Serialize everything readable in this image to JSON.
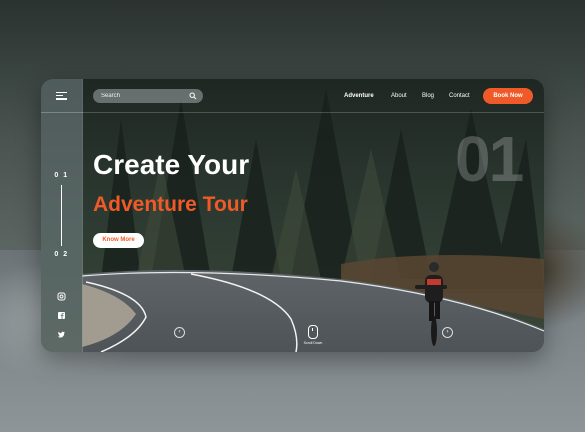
{
  "search": {
    "placeholder": "Search"
  },
  "nav": {
    "items": [
      {
        "label": "Adventure"
      },
      {
        "label": "About"
      },
      {
        "label": "Blog"
      },
      {
        "label": "Contact"
      }
    ],
    "cta_label": "Book Now"
  },
  "hero": {
    "slide_number": "01",
    "headline_line1": "Create Your",
    "headline_line2": "Adventure Tour",
    "cta_label": "Know More"
  },
  "pager": {
    "current": "0 1",
    "next": "0 2"
  },
  "social": [
    {
      "icon": "instagram-icon"
    },
    {
      "icon": "facebook-icon"
    },
    {
      "icon": "twitter-icon"
    }
  ],
  "scroll": {
    "label": "Scroll Down"
  },
  "colors": {
    "accent": "#f05a28",
    "forest": "#2f3a33",
    "road": "#5a6165"
  }
}
